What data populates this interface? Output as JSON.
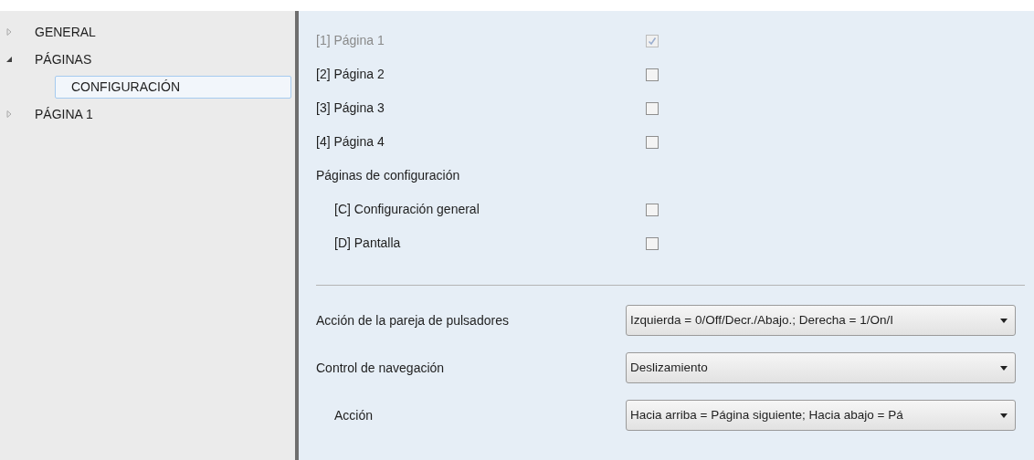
{
  "tree": [
    {
      "label": "GENERAL",
      "expanded": false,
      "selected": false
    },
    {
      "label": "PÁGINAS",
      "expanded": true,
      "selected": false,
      "children": [
        {
          "label": "CONFIGURACIÓN",
          "selected": true
        }
      ]
    },
    {
      "label": "PÁGINA 1",
      "expanded": false,
      "selected": false
    }
  ],
  "options": [
    {
      "kind": "checkbox",
      "label": "[1] Página 1",
      "checked": true,
      "disabled": true
    },
    {
      "kind": "checkbox",
      "label": "[2] Página 2",
      "checked": false,
      "disabled": false
    },
    {
      "kind": "checkbox",
      "label": "[3] Página 3",
      "checked": false,
      "disabled": false
    },
    {
      "kind": "checkbox",
      "label": "[4] Página 4",
      "checked": false,
      "disabled": false
    },
    {
      "kind": "heading",
      "label": "Páginas de configuración",
      "children": [
        {
          "kind": "checkbox",
          "label": "[C] Configuración general",
          "checked": false,
          "disabled": false
        },
        {
          "kind": "checkbox",
          "label": "[D] Pantalla",
          "checked": false,
          "disabled": false
        }
      ]
    }
  ],
  "dropdowns": [
    {
      "label": "Acción de la pareja de pulsadores",
      "value": "Izquierda = 0/Off/Decr./Abajo.; Derecha = 1/On/I"
    },
    {
      "label": "Control de navegación",
      "value": "Deslizamiento",
      "children": [
        {
          "label": "Acción",
          "value": "Hacia arriba = Página siguiente; Hacia abajo = Pá"
        }
      ]
    }
  ]
}
